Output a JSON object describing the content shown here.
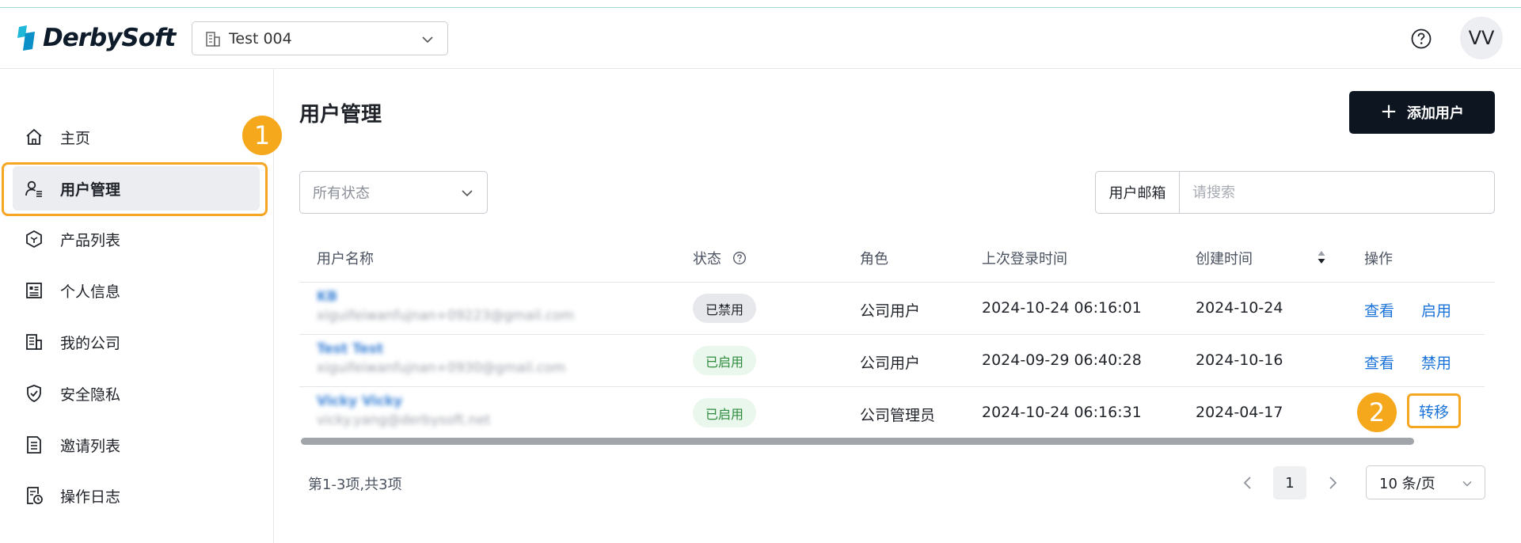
{
  "header": {
    "logo_text": "DerbySoft",
    "company_select": {
      "value": "Test 004"
    },
    "avatar_initials": "VV"
  },
  "sidebar": {
    "items": [
      {
        "label": "主页",
        "icon": "home-icon"
      },
      {
        "label": "用户管理",
        "icon": "user-manage-icon",
        "active": true
      },
      {
        "label": "产品列表",
        "icon": "cube-icon"
      },
      {
        "label": "个人信息",
        "icon": "profile-card-icon"
      },
      {
        "label": "我的公司",
        "icon": "building-icon"
      },
      {
        "label": "安全隐私",
        "icon": "shield-check-icon"
      },
      {
        "label": "邀请列表",
        "icon": "document-list-icon"
      },
      {
        "label": "操作日志",
        "icon": "log-clock-icon"
      }
    ]
  },
  "annotations": {
    "step1": "1",
    "step2": "2",
    "highlight_color": "#f5a623"
  },
  "main": {
    "title": "用户管理",
    "add_button": {
      "label": "添加用户",
      "icon": "plus-icon"
    },
    "status_filter": {
      "placeholder": "所有状态"
    },
    "search": {
      "addon_label": "用户邮箱",
      "placeholder": "请搜索"
    },
    "table": {
      "headers": {
        "name": "用户名称",
        "status": "状态",
        "role": "角色",
        "last_login": "上次登录时间",
        "created": "创建时间",
        "actions": "操作"
      },
      "rows": [
        {
          "name": "KB",
          "email": "xiguifeiwanfujnan+09223@gmail.com",
          "status": "已禁用",
          "role": "公司用户",
          "last_login": "2024-10-24 06:16:01",
          "created": "2024-10-24",
          "action1": "查看",
          "action2": "启用"
        },
        {
          "name": "Test Test",
          "email": "xiguifeiwanfujnan+0930@gmail.com",
          "status": "已启用",
          "role": "公司用户",
          "last_login": "2024-09-29 06:40:28",
          "created": "2024-10-16",
          "action1": "查看",
          "action2": "禁用"
        },
        {
          "name": "Vicky Vicky",
          "email": "vicky.yang@derbysoft.net",
          "status": "已启用",
          "role": "公司管理员",
          "last_login": "2024-10-24 06:16:31",
          "created": "2024-04-17",
          "action1": "转移"
        }
      ]
    },
    "pagination": {
      "summary": "第1-3项,共3项",
      "current_page": "1",
      "page_size": "10 条/页"
    }
  },
  "colors": {
    "accent_dark": "#0d1620",
    "link": "#1a73d9",
    "enabled_text": "#2e8b3e",
    "annotation": "#f5a81c"
  }
}
